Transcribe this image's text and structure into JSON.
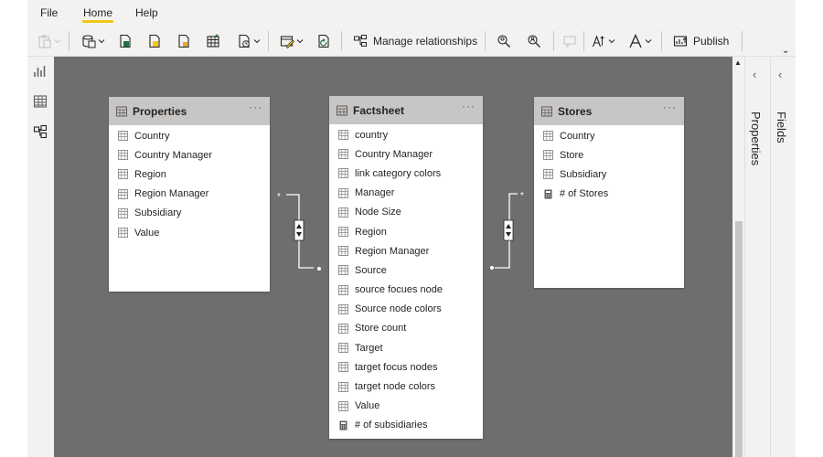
{
  "menu": {
    "file": "File",
    "home": "Home",
    "help": "Help"
  },
  "ribbon": {
    "manage_relationships": "Manage relationships",
    "publish": "Publish"
  },
  "panes": {
    "properties": "Properties",
    "fields": "Fields"
  },
  "tables": [
    {
      "title": "Properties",
      "fields": [
        {
          "name": "Country",
          "icon": "table-column-icon"
        },
        {
          "name": "Country Manager",
          "icon": "table-column-icon"
        },
        {
          "name": "Region",
          "icon": "table-column-icon"
        },
        {
          "name": "Region Manager",
          "icon": "table-column-icon"
        },
        {
          "name": "Subsidiary",
          "icon": "table-column-icon"
        },
        {
          "name": "Value",
          "icon": "table-column-icon"
        }
      ]
    },
    {
      "title": "Factsheet",
      "fields": [
        {
          "name": "country",
          "icon": "table-column-icon"
        },
        {
          "name": "Country Manager",
          "icon": "table-column-icon"
        },
        {
          "name": "link category colors",
          "icon": "table-column-icon"
        },
        {
          "name": "Manager",
          "icon": "table-column-icon"
        },
        {
          "name": "Node Size",
          "icon": "table-column-icon"
        },
        {
          "name": "Region",
          "icon": "table-column-icon"
        },
        {
          "name": "Region Manager",
          "icon": "table-column-icon"
        },
        {
          "name": "Source",
          "icon": "table-column-icon"
        },
        {
          "name": "source focues node",
          "icon": "table-column-icon"
        },
        {
          "name": "Source node colors",
          "icon": "table-column-icon"
        },
        {
          "name": "Store count",
          "icon": "table-column-icon"
        },
        {
          "name": "Target",
          "icon": "table-column-icon"
        },
        {
          "name": "target focus nodes",
          "icon": "table-column-icon"
        },
        {
          "name": "target node colors",
          "icon": "table-column-icon"
        },
        {
          "name": "Value",
          "icon": "table-column-icon"
        },
        {
          "name": "# of subsidiaries",
          "icon": "calculator-icon"
        }
      ]
    },
    {
      "title": "Stores",
      "fields": [
        {
          "name": "Country",
          "icon": "table-column-icon"
        },
        {
          "name": "Store",
          "icon": "table-column-icon"
        },
        {
          "name": "Subsidiary",
          "icon": "table-column-icon"
        },
        {
          "name": "# of Stores",
          "icon": "calculator-icon"
        }
      ]
    }
  ],
  "relationships": [
    {
      "one_side": "*",
      "many_side": "1"
    },
    {
      "one_side": "1",
      "many_side": "*"
    }
  ],
  "colors": {
    "canvas": "#6e6e6e",
    "accent": "#f2c811",
    "header": "#c8c6c4",
    "chrome": "#f3f2f1"
  }
}
